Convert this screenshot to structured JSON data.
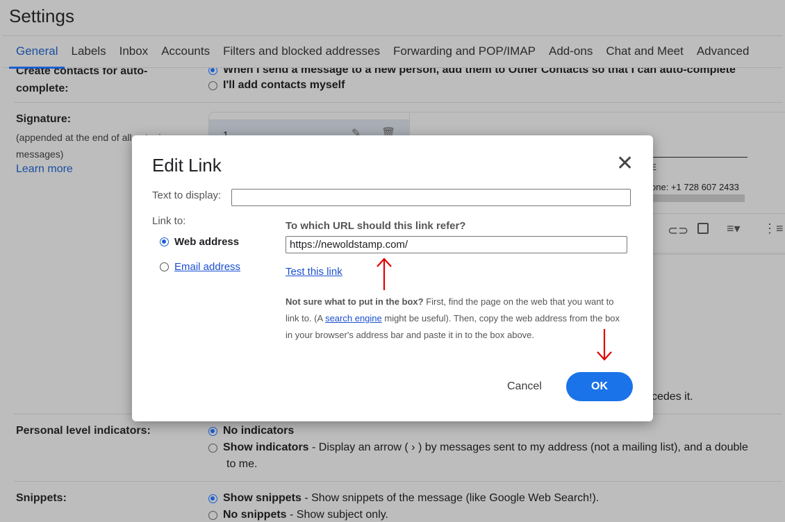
{
  "header": {
    "title": "Settings"
  },
  "tabs": [
    {
      "label": "General",
      "active": true
    },
    {
      "label": "Labels"
    },
    {
      "label": "Inbox"
    },
    {
      "label": "Accounts"
    },
    {
      "label": "Filters and blocked addresses"
    },
    {
      "label": "Forwarding and POP/IMAP"
    },
    {
      "label": "Add-ons"
    },
    {
      "label": "Chat and Meet"
    },
    {
      "label": "Advanced"
    }
  ],
  "settings": {
    "contacts": {
      "label": "Create contacts for auto-complete:",
      "options": [
        "When I send a message to a new person, add them to Other Contacts so that I can auto-complete",
        "I'll add contacts myself"
      ],
      "selected": 0
    },
    "signature": {
      "label": "Signature:",
      "desc": "(appended at the end of all outgoing messages)",
      "learn_more": "Learn more",
      "item": "1",
      "preview_phone": "one: +1 728 607 2433",
      "preview_letter": "E",
      "trailing_text": "cedes it."
    },
    "personal": {
      "label": "Personal level indicators:",
      "opt1": "No indicators",
      "opt2_bold": "Show indicators",
      "opt2_rest": " - Display an arrow ( › ) by messages sent to my address (not a mailing list), and a double",
      "opt2_cont": "to me."
    },
    "snippets": {
      "label": "Snippets:",
      "opt1_bold": "Show snippets",
      "opt1_rest": " - Show snippets of the message (like Google Web Search!).",
      "opt2_bold": "No snippets",
      "opt2_rest": " - Show subject only."
    }
  },
  "dialog": {
    "title": "Edit Link",
    "text_to_display_label": "Text to display:",
    "text_to_display_value": "",
    "link_to_label": "Link to:",
    "options": [
      {
        "label": "Web address",
        "selected": true
      },
      {
        "label": "Email address",
        "selected": false
      }
    ],
    "url_question": "To which URL should this link refer?",
    "url_value": "https://newoldstamp.com/",
    "test_link": "Test this link",
    "help_bold": "Not sure what to put in the box?",
    "help_1": " First, find the page on the web that you want to link to. (A ",
    "help_link": "search engine",
    "help_2": " might be useful). Then, copy the web address from the box in your browser's address bar and paste it in to the box above.",
    "cancel": "Cancel",
    "ok": "OK"
  },
  "colors": {
    "accent": "#1a73e8",
    "annotation_arrow": "#e00000"
  }
}
